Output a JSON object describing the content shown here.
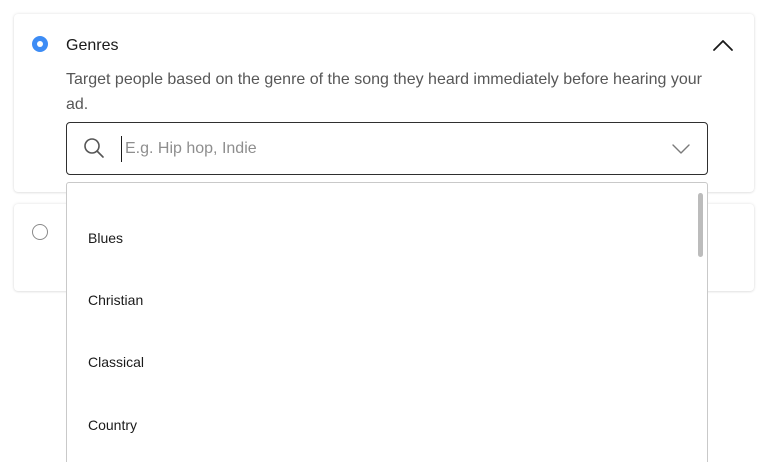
{
  "genres_card": {
    "title": "Genres",
    "description": "Target people based on the genre of the song they heard immediately before hearing your ad.",
    "selected": true,
    "search": {
      "placeholder": "E.g. Hip hop, Indie",
      "value": ""
    },
    "icons": {
      "collapse": "chevron-up-icon",
      "search": "search-icon",
      "dropdown": "chevron-down-icon"
    }
  },
  "second_card": {
    "selected": false
  },
  "dropdown": {
    "options": [
      "Blues",
      "Christian",
      "Classical",
      "Country"
    ]
  },
  "colors": {
    "accent": "#3d8cf5",
    "border": "#2f2f2f",
    "muted_text": "#575757",
    "placeholder": "#8e8e8e"
  }
}
